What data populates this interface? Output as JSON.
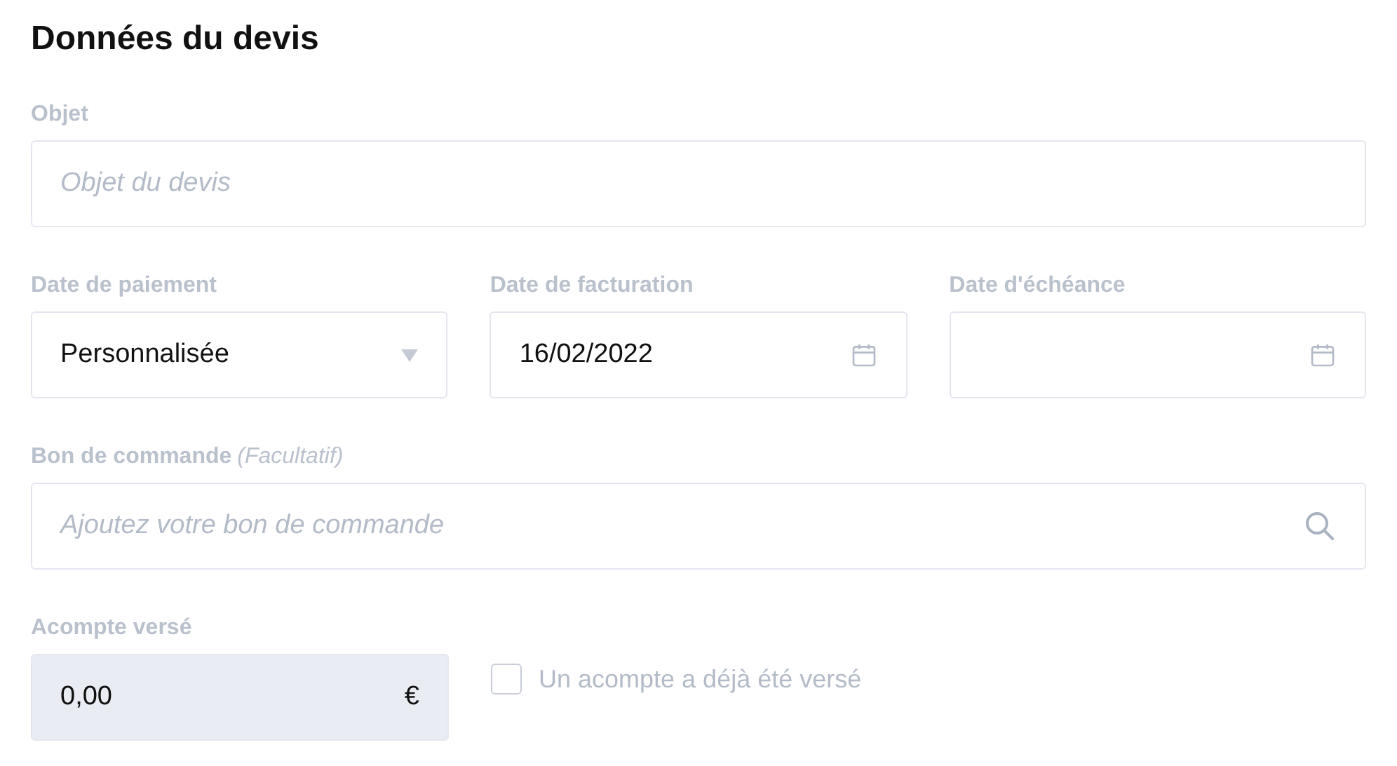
{
  "title": "Données du devis",
  "objet": {
    "label": "Objet",
    "placeholder": "Objet du devis"
  },
  "dates": [
    {
      "kind": "select",
      "label": "Date de paiement",
      "value": "Personnalisée"
    },
    {
      "kind": "date",
      "label": "Date de facturation",
      "value": "16/02/2022"
    },
    {
      "kind": "date",
      "label": "Date d'échéance"
    }
  ],
  "bon_de_commande": {
    "label": "Bon de commande",
    "hint": "(Facultatif)",
    "placeholder": "Ajoutez votre bon de commande"
  },
  "acompte": {
    "label": "Acompte versé",
    "value": "0,00",
    "currency": "€",
    "disabled": true,
    "checkbox": {
      "label": "Un acompte a déjà été versé",
      "checked": false
    }
  }
}
